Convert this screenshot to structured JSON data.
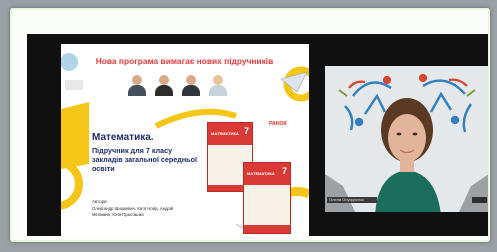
{
  "slide": {
    "banner": "Нова програма вимагає нових підручників",
    "title": "Математика.",
    "subtitle": "Підручник для 7 класу закладів загальної середньої освіти",
    "authors_label": "Автори:",
    "authors": "Олександр Шишкевич, Катя Нойд, Андрій Мелимин, Юля Прасташко",
    "publisher_logo": "РАНОК",
    "book_cover_title": "МАТЕМАТИКА",
    "book_grade": "7"
  },
  "webcam": {
    "participant_name": "Олена Онуфрієнко"
  },
  "colors": {
    "banner_red": "#e53a3a",
    "title_navy": "#1d2b6c",
    "accent_yellow": "#f5c518",
    "book_red": "#d93a35",
    "stage_black": "#101010"
  }
}
